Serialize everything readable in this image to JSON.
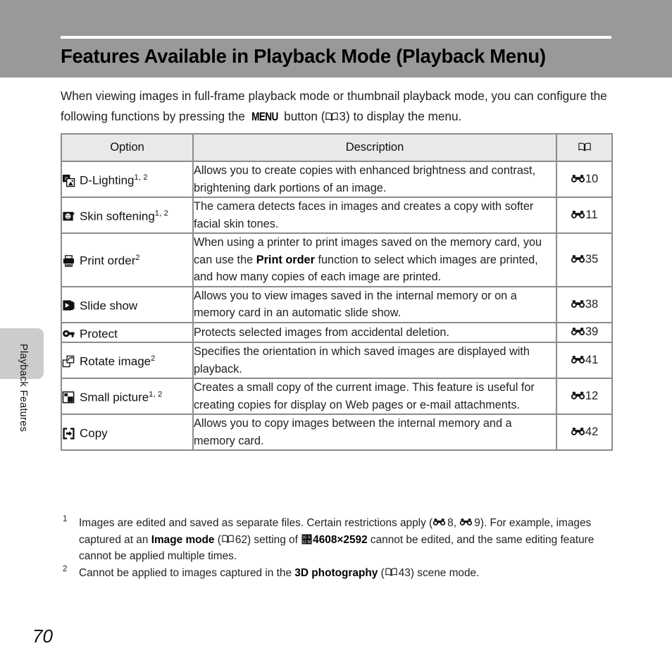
{
  "header": {
    "title": "Features Available in Playback Mode (Playback Menu)"
  },
  "side_tab": {
    "label": "Playback Features"
  },
  "page_number": "70",
  "intro": {
    "part1": "When viewing images in full-frame playback mode or thumbnail playback mode, you can configure the following functions by pressing the ",
    "menu_glyph": "MENU",
    "part2": " button (",
    "ref_page": "3",
    "part3": ") to display the menu."
  },
  "table": {
    "headers": {
      "option": "Option",
      "description": "Description",
      "reference": "book-icon"
    },
    "rows": [
      {
        "icon": "d-lighting-icon",
        "option": "D-Lighting",
        "option_sup": "1, 2",
        "description": "Allows you to create copies with enhanced brightness and contrast, brightening dark portions of an image.",
        "ref": "10"
      },
      {
        "icon": "skin-softening-icon",
        "option": "Skin softening",
        "option_sup": "1, 2",
        "description": "The camera detects faces in images and creates a copy with softer facial skin tones.",
        "ref": "11"
      },
      {
        "icon": "print-order-icon",
        "option": "Print order",
        "option_sup": "2",
        "description_pre": "When using a printer to print images saved on the memory card, you can use the ",
        "description_bold": "Print order",
        "description_post": " function to select which images are printed, and how many copies of each image are printed.",
        "ref": "35"
      },
      {
        "icon": "slide-show-icon",
        "option": "Slide show",
        "option_sup": "",
        "description": "Allows you to view images saved in the internal memory or on a memory card in an automatic slide show.",
        "ref": "38"
      },
      {
        "icon": "protect-icon",
        "option": "Protect",
        "option_sup": "",
        "description": "Protects selected images from accidental deletion.",
        "ref": "39"
      },
      {
        "icon": "rotate-image-icon",
        "option": "Rotate image",
        "option_sup": "2",
        "description": "Specifies the orientation in which saved images are displayed with playback.",
        "ref": "41"
      },
      {
        "icon": "small-picture-icon",
        "option": "Small picture",
        "option_sup": "1, 2",
        "description": "Creates a small copy of the current image. This feature is useful for creating copies for display on Web pages or e-mail attachments.",
        "ref": "12"
      },
      {
        "icon": "copy-icon",
        "option": "Copy",
        "option_sup": "",
        "description": "Allows you to copy images between the internal memory and a memory card.",
        "ref": "42"
      }
    ]
  },
  "footnotes": [
    {
      "mark": "1",
      "t1": "Images are edited and saved as separate files. Certain restrictions apply (",
      "ref_a": "8",
      "sep": ", ",
      "ref_b": "9",
      "t2": "). For example, images captured at an ",
      "bold_a": "Image mode",
      "t3": " (",
      "ref_c": "62",
      "t4": ") setting of ",
      "bold_b": "4608×2592",
      "t5": " cannot be edited, and the same editing feature cannot be applied multiple times."
    },
    {
      "mark": "2",
      "t1": "Cannot be applied to images captured in the ",
      "bold_a": "3D photography",
      "t2": " (",
      "ref_c": "43",
      "t3": ") scene mode."
    }
  ],
  "colors": {
    "header_band": "#999999",
    "header_rule": "#ffffff",
    "side_tab": "#cccccc",
    "table_border": "#8c8c8c",
    "table_header_bg": "#e9e9e9",
    "text": "#222222"
  }
}
